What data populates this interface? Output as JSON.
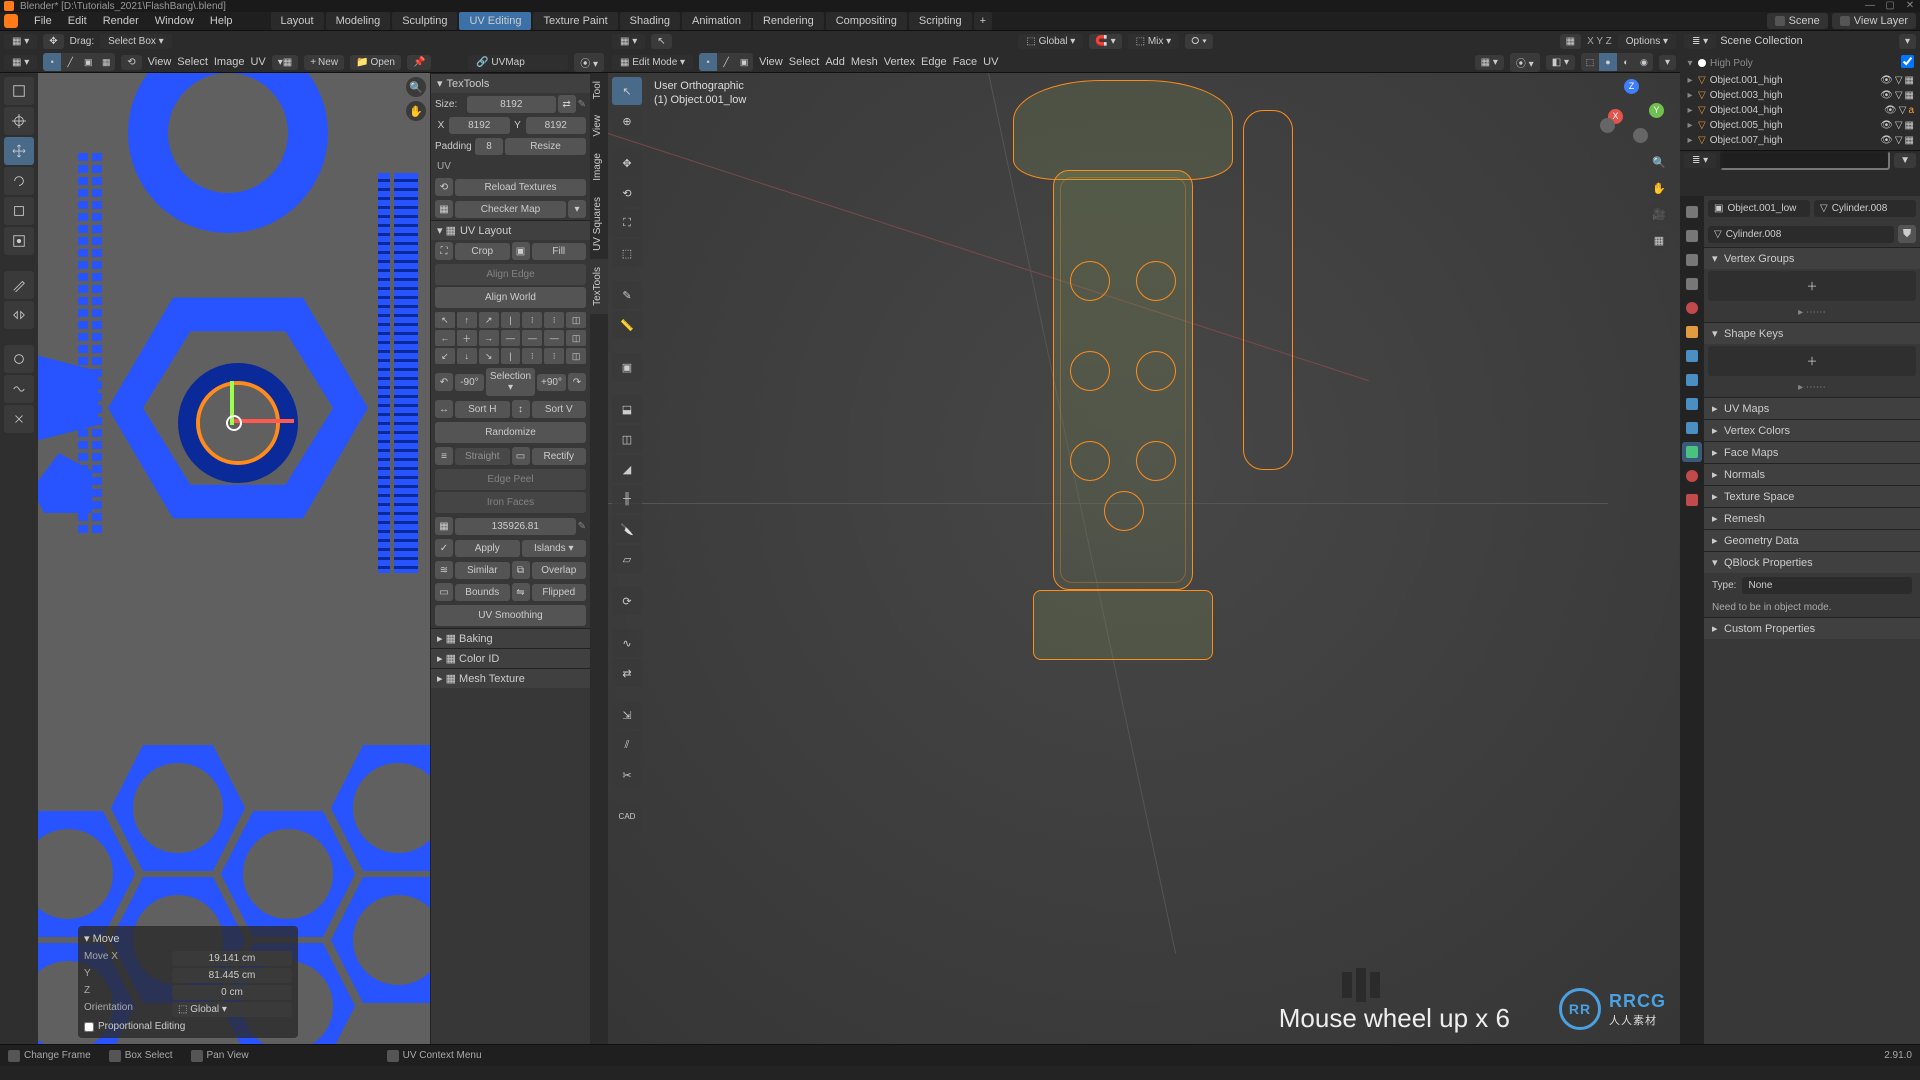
{
  "titlebar": {
    "title": "Blender* [D:\\Tutorials_2021\\FlashBang\\.blend]"
  },
  "menu": {
    "file": "File",
    "edit": "Edit",
    "render": "Render",
    "window": "Window",
    "help": "Help"
  },
  "workspaces": [
    "Layout",
    "Modeling",
    "Sculpting",
    "UV Editing",
    "Texture Paint",
    "Shading",
    "Animation",
    "Rendering",
    "Compositing",
    "Scripting"
  ],
  "active_workspace": "UV Editing",
  "scene_selector": {
    "scene": "Scene",
    "viewlayer": "View Layer"
  },
  "uv_header1": {
    "drag_label": "Drag:",
    "drag_mode": "Select Box"
  },
  "uv_header2": {
    "view": "View",
    "select": "Select",
    "image": "Image",
    "uv": "UV",
    "new": "New",
    "open": "Open"
  },
  "uvmap_selector": "UVMap",
  "textools": {
    "panel_title": "TexTools",
    "size_label": "Size:",
    "size_val": "8192",
    "size_x_label": "X",
    "size_x": "8192",
    "size_y_label": "Y",
    "size_y": "8192",
    "padding_label": "Padding",
    "padding_val": "8",
    "resize": "Resize",
    "uv_heading": "UV",
    "reload_textures": "Reload Textures",
    "checker_map": "Checker Map",
    "uv_layout_hdr": "UV Layout",
    "crop": "Crop",
    "fill": "Fill",
    "align_edge": "Align Edge",
    "align_world": "Align World",
    "rot_neg": "-90°",
    "rot_pos": "+90°",
    "selection": "Selection",
    "sort_h": "Sort H",
    "sort_v": "Sort V",
    "randomize": "Randomize",
    "straight": "Straight",
    "rectify": "Rectify",
    "edge_peel": "Edge Peel",
    "iron_faces": "Iron Faces",
    "texel_value": "135926.81",
    "apply": "Apply",
    "islands": "Islands",
    "similar": "Similar",
    "overlap": "Overlap",
    "bounds": "Bounds",
    "flipped": "Flipped",
    "uv_smoothing": "UV Smoothing",
    "baking": "Baking",
    "color_id": "Color ID",
    "mesh_texture": "Mesh Texture"
  },
  "vp_header1": {
    "global": "Global"
  },
  "vp_header2": {
    "mode": "Edit Mode",
    "view": "View",
    "select": "Select",
    "add": "Add",
    "mesh": "Mesh",
    "vertex": "Vertex",
    "edge": "Edge",
    "face": "Face",
    "uv": "UV",
    "options": "Options",
    "mix": "Mix"
  },
  "vp_info": {
    "line1": "User Orthographic",
    "line2": "(1) Object.001_low"
  },
  "vp_overlay": "Mouse wheel up x 6",
  "watermark": {
    "logo_text": "RR",
    "brand": "RRCG",
    "sub": "人人素材"
  },
  "move_panel": {
    "title": "Move",
    "x_label": "Move X",
    "x_val": "19.141 cm",
    "y_label": "Y",
    "y_val": "81.445 cm",
    "z_label": "Z",
    "z_val": "0 cm",
    "orientation_label": "Orientation",
    "orientation_val": "Global",
    "prop_edit": "Proportional Editing"
  },
  "outliner": {
    "hdr": "Scene Collection",
    "highpoly": "High Poly",
    "items": [
      "Object.001_high",
      "Object.003_high",
      "Object.004_high",
      "Object.005_high",
      "Object.007_high"
    ],
    "search_placeholder": ""
  },
  "props": {
    "breadcrumb_obj": "Object.001_low",
    "breadcrumb_mesh": "Cylinder.008",
    "mesh_name": "Cylinder.008",
    "sec_vertex_groups": "Vertex Groups",
    "sec_shape_keys": "Shape Keys",
    "sec_uv_maps": "UV Maps",
    "sec_vertex_colors": "Vertex Colors",
    "sec_face_maps": "Face Maps",
    "sec_normals": "Normals",
    "sec_texture_space": "Texture Space",
    "sec_remesh": "Remesh",
    "sec_geometry_data": "Geometry Data",
    "sec_qblock": "QBlock Properties",
    "type_label": "Type:",
    "type_val": "None",
    "qblock_note": "Need to be in object mode.",
    "sec_custom": "Custom Properties"
  },
  "statusbar": {
    "change_frame": "Change Frame",
    "box_select": "Box Select",
    "pan_view": "Pan View",
    "uv_context": "UV Context Menu",
    "version": "2.91.0"
  },
  "vert_tabs": [
    "Tool",
    "View",
    "Image",
    "UV Squares",
    "TexTools"
  ]
}
